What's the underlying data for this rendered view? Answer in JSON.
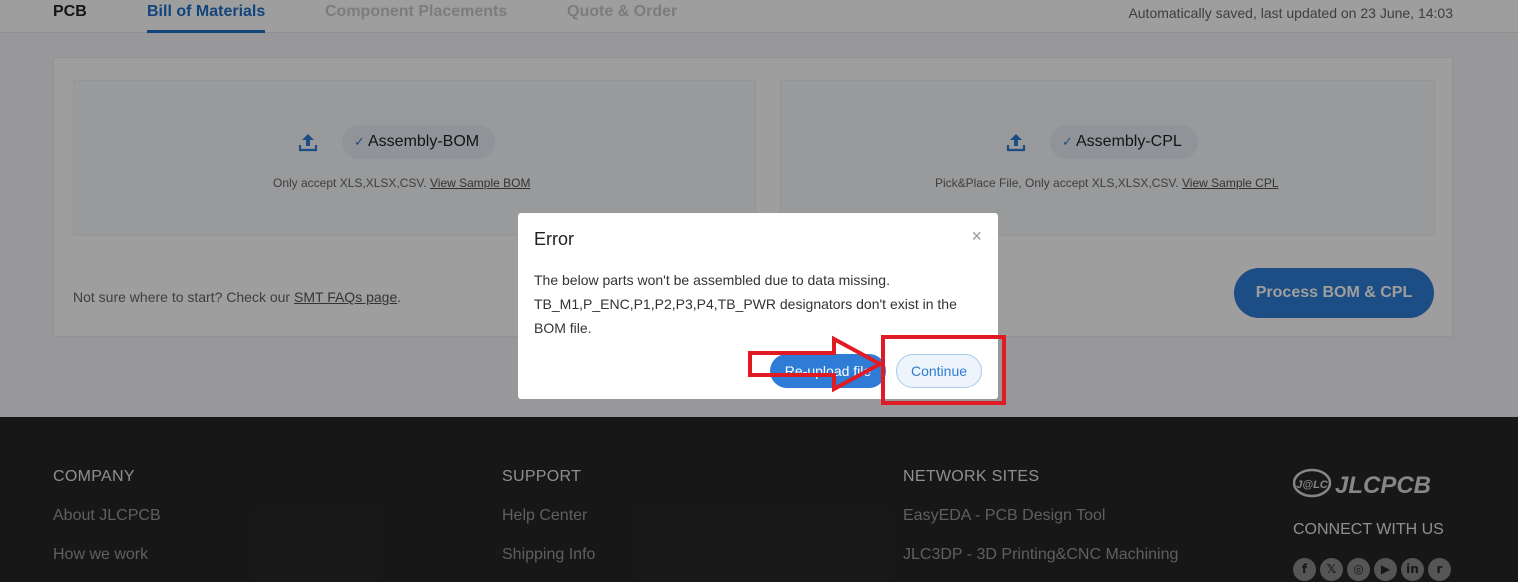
{
  "tabs": {
    "pcb": "PCB",
    "bom": "Bill of Materials",
    "cpl": "Component Placements",
    "quote": "Quote & Order",
    "saved_status": "Automatically saved, last updated on 23 June, 14:03"
  },
  "upload": {
    "bom": {
      "file_label": "Assembly-BOM",
      "hint": "Only accept XLS,XLSX,CSV.",
      "sample_link": "View Sample BOM"
    },
    "cpl": {
      "file_label": "Assembly-CPL",
      "hint": "Pick&Place File, Only accept XLS,XLSX,CSV.",
      "sample_link": "View Sample CPL"
    },
    "faq_text": "Not sure where to start? Check our",
    "faq_link": "SMT FAQs page",
    "faq_end": ".",
    "process_button": "Process BOM & CPL"
  },
  "modal": {
    "title": "Error",
    "line1": "The below parts won't be assembled due to data missing.",
    "line2": "TB_M1,P_ENC,P1,P2,P3,P4,TB_PWR designators don't exist in the",
    "line3": "BOM file.",
    "reupload_button": "Re-upload file",
    "continue_button": "Continue",
    "close_symbol": "×"
  },
  "footer": {
    "company": {
      "heading": "COMPANY",
      "links": [
        "About JLCPCB",
        "How we work"
      ]
    },
    "support": {
      "heading": "SUPPORT",
      "links": [
        "Help Center",
        "Shipping Info"
      ]
    },
    "network": {
      "heading": "NETWORK SITES",
      "links": [
        "EasyEDA - PCB Design Tool",
        "JLC3DP - 3D Printing&CNC Machining"
      ]
    },
    "logo_text": "JLCPCB",
    "logo_mark": "J@LC",
    "connect": "CONNECT WITH US",
    "socials": [
      "f",
      "𝕏",
      "◎",
      "▶",
      "in",
      "r"
    ]
  },
  "colors": {
    "accent": "#2e7cd6",
    "annotation": "#e01b24",
    "footer_bg": "#262626"
  }
}
